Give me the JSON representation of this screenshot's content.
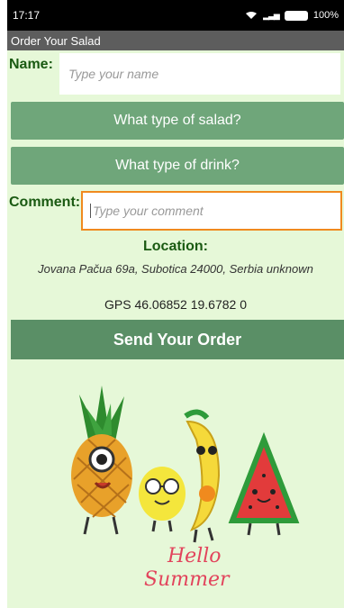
{
  "status_bar": {
    "time": "17:17",
    "battery": "100%"
  },
  "app": {
    "title": "Order Your Salad"
  },
  "form": {
    "name_label": "Name:",
    "name_placeholder": "Type your name",
    "salad_button": "What type of salad?",
    "drink_button": "What type of drink?",
    "comment_label": "Comment:",
    "comment_placeholder": "Type your comment"
  },
  "location": {
    "title": "Location:",
    "address": "Jovana Pačua 69a, Subotica 24000, Serbia unknown",
    "gps": "GPS 46.06852 19.6782 0"
  },
  "actions": {
    "send_label": "Send Your Order"
  },
  "illustration": {
    "caption_line1": "Hello",
    "caption_line2": "Summer"
  },
  "colors": {
    "background": "#e6f8d8",
    "button": "#6fa67a",
    "label_green": "#1a5a12",
    "focus_border": "#f08a1e",
    "title_bar": "#5d5d5d"
  }
}
